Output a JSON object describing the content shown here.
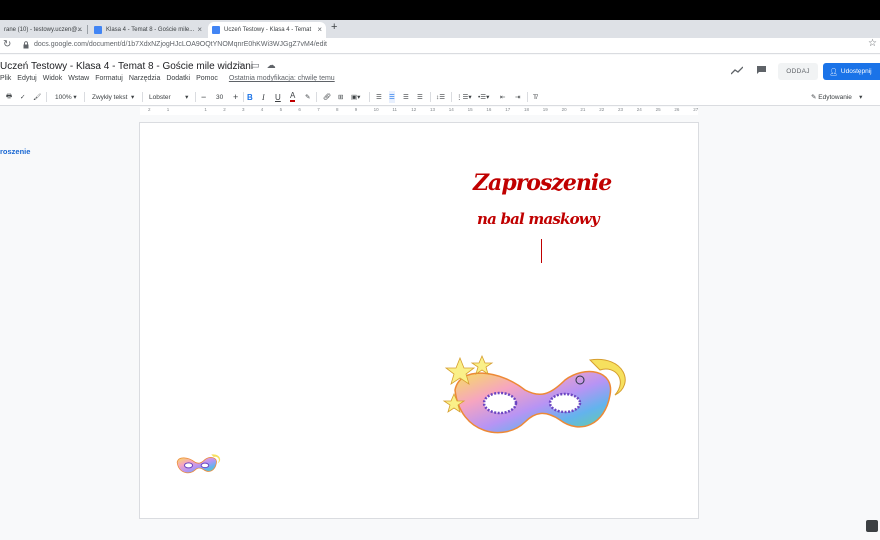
{
  "browser": {
    "tabs": [
      {
        "label": "rane (10) - testowy.uczen@..."
      },
      {
        "label": "Klasa 4 - Temat 8 - Goście mile..."
      },
      {
        "label": "Uczeń Testowy - Klasa 4 - Temat"
      }
    ],
    "url": "docs.google.com/document/d/1b7XdxNZjogHJcLOA9OQtYNOMqnrE0hKWi3WJGgZ7vM4/edit"
  },
  "doc": {
    "title": "Uczeń Testowy - Klasa 4 - Temat 8 - Goście mile widziani",
    "menu": [
      "Plik",
      "Edytuj",
      "Widok",
      "Wstaw",
      "Formatuj",
      "Narzędzia",
      "Dodatki",
      "Pomoc"
    ],
    "last_modified": "Ostatnia modyfikacja: chwilę temu",
    "oddaj_label": "ODDAJ",
    "share_label": "Udostępnij",
    "editing_label": "Edytowanie"
  },
  "toolbar": {
    "zoom": "100%",
    "style": "Zwykły tekst",
    "font": "Lobster",
    "size": "30"
  },
  "ruler": {
    "ticks": [
      "2",
      "1",
      "",
      "1",
      "2",
      "3",
      "4",
      "5",
      "6",
      "7",
      "8",
      "9",
      "10",
      "11",
      "12",
      "13",
      "14",
      "15",
      "16",
      "17",
      "18",
      "19",
      "20",
      "21",
      "22",
      "23",
      "24",
      "25",
      "26",
      "27"
    ]
  },
  "outline": {
    "item": "roszenie"
  },
  "content": {
    "heading": "Zaproszenie",
    "subheading": "na bal maskowy"
  },
  "colors": {
    "heading": "#c00000",
    "share": "#1a73e8",
    "outline": "#1967d2"
  }
}
